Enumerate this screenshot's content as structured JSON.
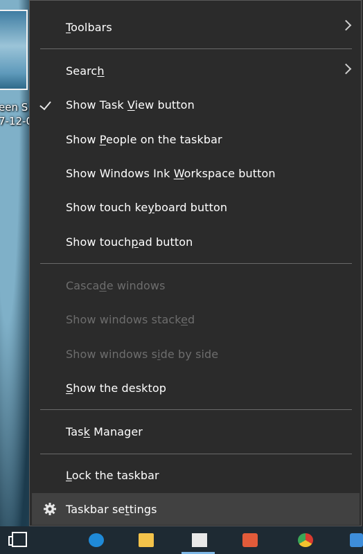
{
  "desktop": {
    "icon_label_line1": "een S",
    "icon_label_line2": "7-12-0"
  },
  "menu": {
    "toolbars": {
      "pre": "",
      "u": "T",
      "post": "oolbars",
      "submenu": true
    },
    "search": {
      "pre": "Searc",
      "u": "h",
      "post": "",
      "submenu": true
    },
    "show_task_view": {
      "pre": "Show Task ",
      "u": "V",
      "post": "iew button",
      "checked": true
    },
    "show_people": {
      "pre": "Show ",
      "u": "P",
      "post": "eople on the taskbar"
    },
    "show_ink": {
      "pre": "Show Windows Ink ",
      "u": "W",
      "post": "orkspace button"
    },
    "show_touch_keyboard": {
      "pre": "Show touch ke",
      "u": "y",
      "post": "board button"
    },
    "show_touchpad": {
      "pre": "Show touch",
      "u": "p",
      "post": "ad button"
    },
    "cascade": {
      "pre": "Casca",
      "u": "d",
      "post": "e windows",
      "enabled": false
    },
    "stacked": {
      "pre": "Show windows stack",
      "u": "e",
      "post": "d",
      "enabled": false
    },
    "side_by_side": {
      "pre": "Show windows s",
      "u": "i",
      "post": "de by side",
      "enabled": false
    },
    "show_desktop": {
      "pre": "",
      "u": "S",
      "post": "how the desktop"
    },
    "task_manager": {
      "pre": "Tas",
      "u": "k",
      "post": " Manager"
    },
    "lock_taskbar": {
      "pre": "",
      "u": "L",
      "post": "ock the taskbar"
    },
    "taskbar_settings": {
      "pre": "Taskbar se",
      "u": "t",
      "post": "tings",
      "highlighted": true
    }
  },
  "icons": {
    "submenu": "chevron-right-icon",
    "check": "checkmark-icon",
    "settings": "gear-icon"
  },
  "colors": {
    "menu_bg": "#2b2b2b",
    "text": "#ffffff",
    "disabled_text": "#6d6d6d",
    "highlight_bg": "#414141",
    "separator": "#6a6a6a"
  }
}
